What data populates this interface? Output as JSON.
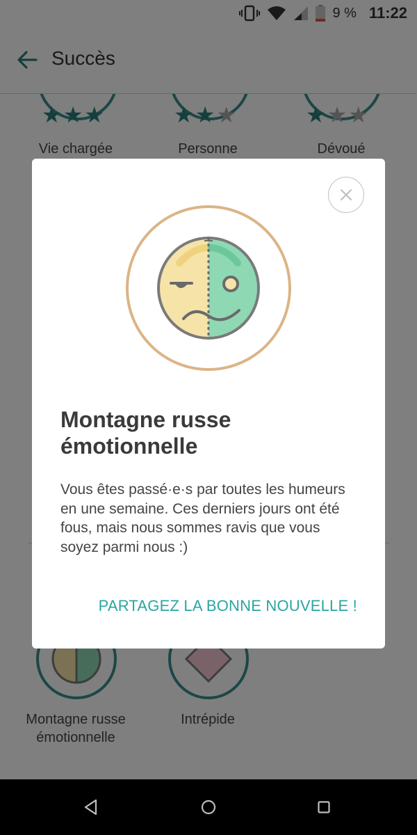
{
  "status_bar": {
    "battery_percent": "9 %",
    "time": "11:22",
    "icons": [
      "vibrate-icon",
      "wifi-icon",
      "cell-signal-icon",
      "battery-icon"
    ]
  },
  "app_bar": {
    "title": "Succès",
    "back_icon": "arrow-left-icon"
  },
  "background_page": {
    "top_badges": [
      {
        "label": "Vie chargée",
        "stars_earned": 3,
        "stars_total": 3
      },
      {
        "label": "Personne",
        "stars_earned": 2,
        "stars_total": 3
      },
      {
        "label": "Dévoué",
        "stars_earned": 1,
        "stars_total": 3
      }
    ],
    "bottom_badges": [
      {
        "label_line1": "Montagne russe",
        "label_line2": "émotionnelle"
      },
      {
        "label_line1": "Intrépide",
        "label_line2": ""
      }
    ]
  },
  "dialog": {
    "close_icon": "close-icon",
    "title": "Montagne russe émotionnelle",
    "body": "Vous êtes passé·e·s par toutes les humeurs en une semaine. Ces derniers jours ont été fous, mais nous sommes ravis que vous soyez parmi nous :)",
    "action_label": "PARTAGEZ LA BONNE NOUVELLE !",
    "colors": {
      "ring": "#dcb486",
      "face_left": "#f6e3a8",
      "face_right": "#8ed9b4",
      "action": "#2aa5a0"
    }
  },
  "nav_bar": {
    "icons": [
      "nav-back-icon",
      "nav-home-icon",
      "nav-recents-icon"
    ]
  }
}
